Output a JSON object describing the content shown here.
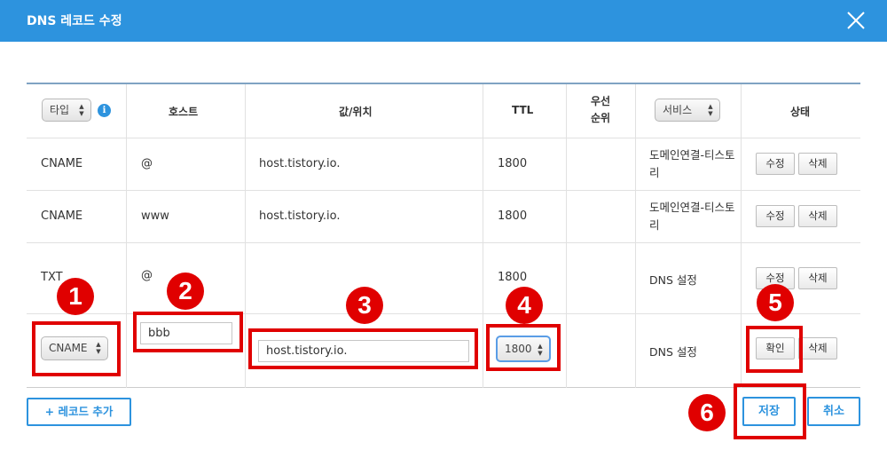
{
  "dialog": {
    "title": "DNS 레코드 수정",
    "close_icon": "close-icon"
  },
  "header": {
    "type_select": "타입",
    "host": "호스트",
    "value": "값/위치",
    "ttl": "TTL",
    "priority_line1": "우선",
    "priority_line2": "순위",
    "service_select": "서비스",
    "status": "상태",
    "info_glyph": "i"
  },
  "rows": [
    {
      "type": "CNAME",
      "host": "@",
      "value": "host.tistory.io.",
      "ttl": "1800",
      "service": "도메인연결-티스토리",
      "edit": "수정",
      "delete": "삭제"
    },
    {
      "type": "CNAME",
      "host": "www",
      "value": "host.tistory.io.",
      "ttl": "1800",
      "service": "도메인연결-티스토리",
      "edit": "수정",
      "delete": "삭제"
    },
    {
      "type": "TXT",
      "host": "@",
      "value": "",
      "ttl": "1800",
      "service": "DNS 설정",
      "edit": "수정",
      "delete": "삭제"
    }
  ],
  "edit_row": {
    "type_value": "CNAME",
    "host_value": "bbb",
    "value_value": "host.tistory.io.",
    "ttl_value": "1800",
    "service": "DNS 설정",
    "confirm": "확인",
    "delete": "삭제"
  },
  "footer": {
    "add_record": "+ 레코드 추가",
    "save": "저장",
    "cancel": "취소"
  },
  "annotations": [
    "1",
    "2",
    "3",
    "4",
    "5",
    "6"
  ],
  "colors": {
    "titlebar": "#2d93de",
    "annotation_red": "#e00000",
    "accent_blue": "#2d93de"
  }
}
